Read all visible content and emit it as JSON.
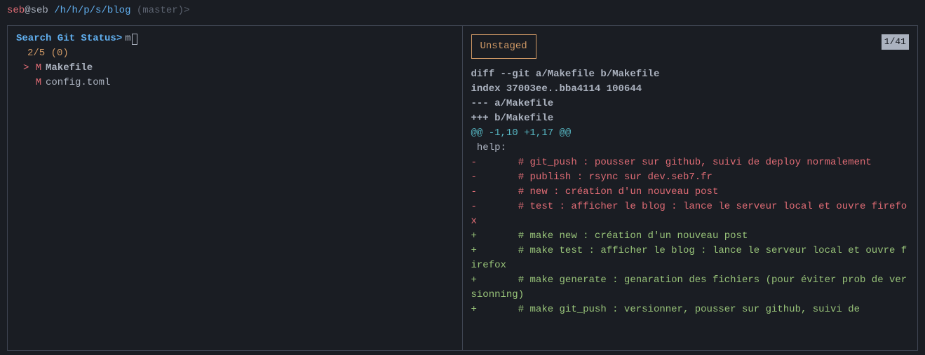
{
  "prompt": {
    "user": "seb",
    "at": "@",
    "host": "seb",
    "path": "/h/h/p/s/blog",
    "branch": "(master)",
    "arrow": ">"
  },
  "search": {
    "prompt": "Search Git Status>",
    "value": "m"
  },
  "counter": "2/5 (0)",
  "files": [
    {
      "marker": ">",
      "status": "M",
      "name": "Makefile",
      "selected": true
    },
    {
      "marker": "",
      "status": "M",
      "name": "config.toml",
      "selected": false
    }
  ],
  "badge": "Unstaged",
  "line_counter": "1/41",
  "diff": {
    "header1": "diff --git a/Makefile b/Makefile",
    "header2": "index 37003ee..bba4114 100644",
    "header3": "--- a/Makefile",
    "header4": "+++ b/Makefile",
    "hunk": "@@ -1,10 +1,17 @@",
    "context1": " help:",
    "removed1": "-       # git_push : pousser sur github, suivi de deploy normalement",
    "removed2": "-       # publish : rsync sur dev.seb7.fr",
    "removed3": "-       # new : création d'un nouveau post",
    "removed4": "-       # test : afficher le blog : lance le serveur local et ouvre firefox",
    "added1": "+       # make new : création d'un nouveau post",
    "added2": "+       # make test : afficher le blog : lance le serveur local et ouvre firefox",
    "added3": "+       # make generate : genaration des fichiers (pour éviter prob de versionning)",
    "added4": "+       # make git_push : versionner, pousser sur github, suivi de"
  }
}
